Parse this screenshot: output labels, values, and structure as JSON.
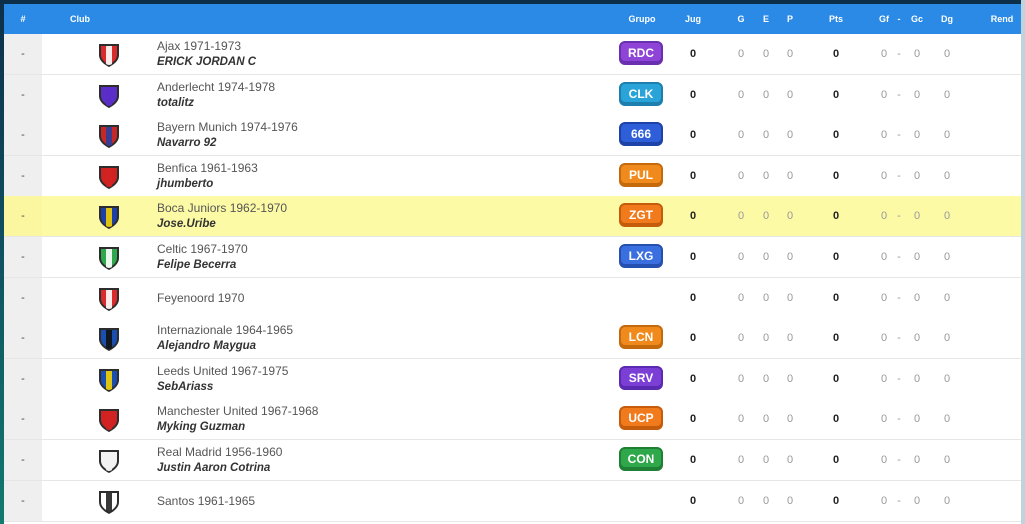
{
  "header": {
    "pos": "#",
    "club": "Club",
    "grupo": "Grupo",
    "jug": "Jug",
    "g": "G",
    "e": "E",
    "p": "P",
    "pts": "Pts",
    "gf": "Gf",
    "dash": "-",
    "gc": "Gc",
    "dg": "Dg",
    "rend": "Rend"
  },
  "rows": [
    {
      "pos": "-",
      "club": "Ajax 1971-1973",
      "user": "ERICK JORDAN C",
      "group": "RDC",
      "group_color": "#8e44d6",
      "group_border": "#6a2fb0",
      "crest_primary": "#d92b2b",
      "crest_secondary": "#ffffff",
      "crest_icon": "ajax-crest-icon",
      "jug": "0",
      "g": "0",
      "e": "0",
      "p": "0",
      "pts": "0",
      "gf": "0",
      "sep": "-",
      "gc": "0",
      "dg": "0"
    },
    {
      "pos": "-",
      "club": "Anderlecht 1974-1978",
      "user": "totalitz",
      "group": "CLK",
      "group_color": "#2aa3d8",
      "group_border": "#1c7fae",
      "crest_primary": "#5b2ec8",
      "crest_secondary": "#5b2ec8",
      "crest_icon": "anderlecht-crest-icon",
      "jug": "0",
      "g": "0",
      "e": "0",
      "p": "0",
      "pts": "0",
      "gf": "0",
      "sep": "-",
      "gc": "0",
      "dg": "0"
    },
    {
      "pos": "-",
      "club": "Bayern Munich 1974-1976",
      "user": "Navarro 92",
      "group": "666",
      "group_color": "#2e5fd8",
      "group_border": "#1d43a8",
      "crest_primary": "#c62828",
      "crest_secondary": "#2c3e9a",
      "crest_icon": "bayern-crest-icon",
      "jug": "0",
      "g": "0",
      "e": "0",
      "p": "0",
      "pts": "0",
      "gf": "0",
      "sep": "-",
      "gc": "0",
      "dg": "0"
    },
    {
      "pos": "-",
      "club": "Benfica 1961-1963",
      "user": "jhumberto",
      "group": "PUL",
      "group_color": "#f08a1c",
      "group_border": "#c46a0c",
      "crest_primary": "#d12222",
      "crest_secondary": "#d12222",
      "crest_icon": "benfica-crest-icon",
      "jug": "0",
      "g": "0",
      "e": "0",
      "p": "0",
      "pts": "0",
      "gf": "0",
      "sep": "-",
      "gc": "0",
      "dg": "0"
    },
    {
      "pos": "-",
      "club": "Boca Juniors 1962-1970",
      "user": "Jose.Uribe",
      "group": "ZGT",
      "group_color": "#f07a1c",
      "group_border": "#c45c0c",
      "crest_primary": "#1c3fa8",
      "crest_secondary": "#f5d000",
      "crest_icon": "boca-crest-icon",
      "highlight": true,
      "jug": "0",
      "g": "0",
      "e": "0",
      "p": "0",
      "pts": "0",
      "gf": "0",
      "sep": "-",
      "gc": "0",
      "dg": "0"
    },
    {
      "pos": "-",
      "club": "Celtic 1967-1970",
      "user": "Felipe Becerra",
      "group": "LXG",
      "group_color": "#3a6fe0",
      "group_border": "#2650b0",
      "crest_primary": "#2ea84a",
      "crest_secondary": "#ffffff",
      "crest_icon": "celtic-crest-icon",
      "jug": "0",
      "g": "0",
      "e": "0",
      "p": "0",
      "pts": "0",
      "gf": "0",
      "sep": "-",
      "gc": "0",
      "dg": "0"
    },
    {
      "pos": "-",
      "club": "Feyenoord 1970",
      "user": "",
      "group": "",
      "crest_primary": "#d92b2b",
      "crest_secondary": "#ffffff",
      "crest_icon": "feyenoord-crest-icon",
      "jug": "0",
      "g": "0",
      "e": "0",
      "p": "0",
      "pts": "0",
      "gf": "0",
      "sep": "-",
      "gc": "0",
      "dg": "0"
    },
    {
      "pos": "-",
      "club": "Internazionale 1964-1965",
      "user": "Alejandro Maygua",
      "group": "LCN",
      "group_color": "#f08a1c",
      "group_border": "#c46a0c",
      "crest_primary": "#1a4fb0",
      "crest_secondary": "#111111",
      "crest_icon": "inter-crest-icon",
      "jug": "0",
      "g": "0",
      "e": "0",
      "p": "0",
      "pts": "0",
      "gf": "0",
      "sep": "-",
      "gc": "0",
      "dg": "0"
    },
    {
      "pos": "-",
      "club": "Leeds United 1967-1975",
      "user": "SebAriass",
      "group": "SRV",
      "group_color": "#7b3fd6",
      "group_border": "#5a2ab0",
      "crest_primary": "#1a4fb0",
      "crest_secondary": "#f5d000",
      "crest_icon": "leeds-crest-icon",
      "jug": "0",
      "g": "0",
      "e": "0",
      "p": "0",
      "pts": "0",
      "gf": "0",
      "sep": "-",
      "gc": "0",
      "dg": "0"
    },
    {
      "pos": "-",
      "club": "Manchester United 1967-1968",
      "user": "Myking Guzman",
      "group": "UCP",
      "group_color": "#f07a1c",
      "group_border": "#c45c0c",
      "crest_primary": "#d12222",
      "crest_secondary": "#d12222",
      "crest_icon": "manutd-crest-icon",
      "jug": "0",
      "g": "0",
      "e": "0",
      "p": "0",
      "pts": "0",
      "gf": "0",
      "sep": "-",
      "gc": "0",
      "dg": "0"
    },
    {
      "pos": "-",
      "club": "Real Madrid 1956-1960",
      "user": "Justin Aaron Cotrina",
      "group": "CON",
      "group_color": "#2ea84a",
      "group_border": "#1f7f35",
      "crest_primary": "#f2f2f2",
      "crest_secondary": "#f2f2f2",
      "crest_icon": "realmadrid-crest-icon",
      "jug": "0",
      "g": "0",
      "e": "0",
      "p": "0",
      "pts": "0",
      "gf": "0",
      "sep": "-",
      "gc": "0",
      "dg": "0"
    },
    {
      "pos": "-",
      "club": "Santos 1961-1965",
      "user": "",
      "group": "",
      "crest_primary": "#ffffff",
      "crest_secondary": "#222222",
      "crest_icon": "santos-crest-icon",
      "jug": "0",
      "g": "0",
      "e": "0",
      "p": "0",
      "pts": "0",
      "gf": "0",
      "sep": "-",
      "gc": "0",
      "dg": "0"
    }
  ]
}
